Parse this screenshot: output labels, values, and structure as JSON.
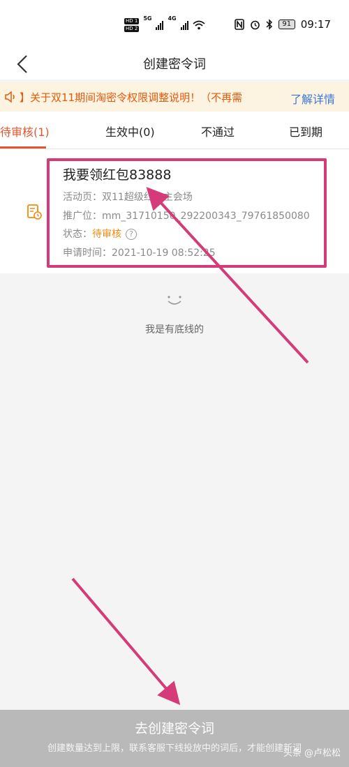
{
  "status_bar": {
    "hd1": "HD 1",
    "hd2": "HD 2",
    "net1": "5G",
    "net2": "4G",
    "battery": "91",
    "time": "09:17"
  },
  "nav": {
    "title": "创建密令词"
  },
  "notice": {
    "text": "】关于双11期间淘密令权限调整说明！（不再需",
    "more": "了解详情"
  },
  "tabs": [
    {
      "label": "待审核(1)"
    },
    {
      "label": "生效中(0)"
    },
    {
      "label": "不通过"
    },
    {
      "label": "已到期"
    }
  ],
  "card": {
    "keyword": "我要领红包83888",
    "activity_label": "活动页：",
    "activity_value": "双11超级红包主会场",
    "position_label": "推广位：",
    "position_value": "mm_31710150_292200343_79761850080",
    "status_label": "状态：",
    "status_value": "待审核",
    "status_help": "?",
    "apply_label": "申请时间：",
    "apply_value": "2021-10-19 08:52:25"
  },
  "empty_hint": "我是有底线的",
  "footer": {
    "create_label": "去创建密令词",
    "note": "创建数量达到上限，联系客服下线投放中的词后，才能创建新词"
  },
  "watermark": "头条 @卢松松",
  "colors": {
    "accent": "#e4572e",
    "status_pending": "#f08a12",
    "link": "#3a78d8",
    "annotation": "#d43b78"
  }
}
